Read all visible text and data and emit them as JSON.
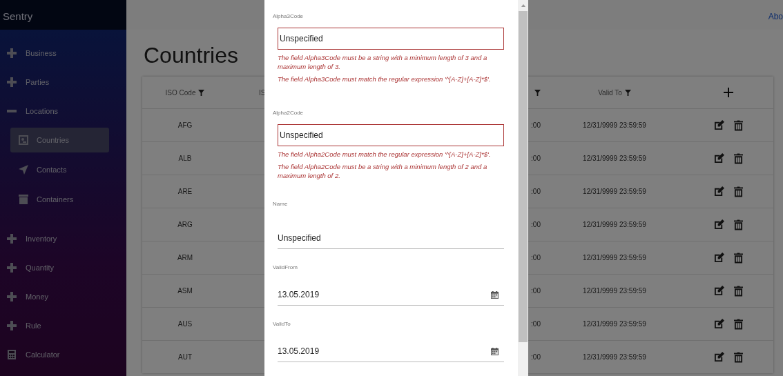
{
  "app_title": "Sentry",
  "top_link": "Abo",
  "sidebar": {
    "items": [
      {
        "label": "Business",
        "expanded": false
      },
      {
        "label": "Parties",
        "expanded": false
      },
      {
        "label": "Locations",
        "expanded": true,
        "children": [
          {
            "label": "Countries",
            "selected": true
          },
          {
            "label": "Contacts",
            "selected": false
          },
          {
            "label": "Containers",
            "selected": false
          }
        ]
      },
      {
        "label": "Inventory",
        "expanded": false
      },
      {
        "label": "Quantity",
        "expanded": false
      },
      {
        "label": "Money",
        "expanded": false
      },
      {
        "label": "Rule",
        "expanded": false
      },
      {
        "label": "Calculator",
        "kind": "calculator"
      }
    ]
  },
  "page_title": "Countries",
  "table": {
    "columns": [
      {
        "label": "ISO Code",
        "filter": true
      },
      {
        "label": "IS"
      },
      {
        "filter": true
      },
      {
        "label": "Valid To",
        "filter": true
      }
    ],
    "rows": [
      {
        "iso": "AFG",
        "column_3": ":00",
        "valid_to": "12/31/9999 23:59:59"
      },
      {
        "iso": "ALB",
        "column_3": ":00",
        "valid_to": "12/31/9999 23:59:59"
      },
      {
        "iso": "ARE",
        "column_3": ":00",
        "valid_to": "12/31/9999 23:59:59"
      },
      {
        "iso": "ARG",
        "column_3": ":00",
        "valid_to": "12/31/9999 23:59:59"
      },
      {
        "iso": "ARM",
        "column_3": ":00",
        "valid_to": "12/31/9999 23:59:59"
      },
      {
        "iso": "ASM",
        "column_3": ":00",
        "valid_to": "12/31/9999 23:59:59"
      },
      {
        "iso": "AUS",
        "column_3": ":00",
        "valid_to": "12/31/9999 23:59:59"
      },
      {
        "iso": "AUT",
        "column_3": ":00",
        "valid_to": "12/31/9999 23:59:59"
      }
    ]
  },
  "dialog": {
    "fields": [
      {
        "label": "Alpha3Code",
        "kind": "text",
        "value": "Unspecified",
        "invalid": true,
        "errors": [
          "The field Alpha3Code must be a string with a minimum length of 3 and a maximum length of 3.",
          "The field Alpha3Code must match the regular expression '^[A-Z]+[A-Z]*$'."
        ]
      },
      {
        "label": "Alpha2Code",
        "kind": "text",
        "value": "Unspecified",
        "invalid": true,
        "errors": [
          "The field Alpha2Code must match the regular expression '^[A-Z]+[A-Z]*$'.",
          "The field Alpha2Code must be a string with a minimum length of 2 and a maximum length of 2."
        ]
      },
      {
        "label": "Name",
        "kind": "text",
        "value": "Unspecified",
        "invalid": false
      },
      {
        "label": "ValidFrom",
        "kind": "date",
        "value": "13.05.2019",
        "invalid": false
      },
      {
        "label": "ValidTo",
        "kind": "date",
        "value": "13.05.2019",
        "invalid": false
      }
    ]
  }
}
